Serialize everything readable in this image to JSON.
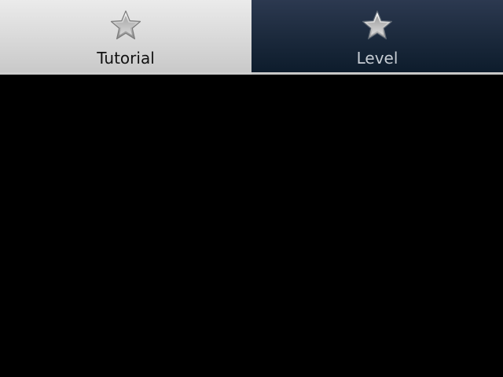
{
  "tabs": [
    {
      "label": "Tutorial",
      "icon": "star-icon",
      "selected": true
    },
    {
      "label": "Level",
      "icon": "star-icon",
      "selected": false
    }
  ],
  "colors": {
    "selected_tab": "#dadada",
    "unselected_tab": "#1c2a3d",
    "content_background": "#000000"
  }
}
